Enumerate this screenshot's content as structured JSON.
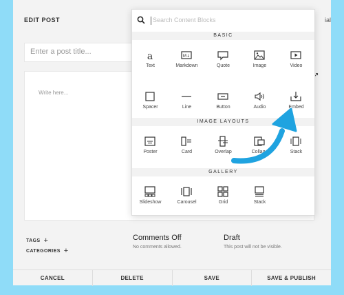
{
  "editor": {
    "title": "EDIT POST",
    "header_fragment": "ial",
    "title_placeholder": "Enter a post title...",
    "body_placeholder": "Write here...",
    "expand_glyph": "↗"
  },
  "popup": {
    "search_placeholder": "Search Content Blocks",
    "sections": {
      "basic": {
        "heading": "BASIC",
        "items": [
          "Text",
          "Markdown",
          "Quote",
          "Image",
          "Video",
          "Spacer",
          "Line",
          "Button",
          "Audio",
          "Embed"
        ]
      },
      "image_layouts": {
        "heading": "IMAGE LAYOUTS",
        "items": [
          "Poster",
          "Card",
          "Overlap",
          "Collage",
          "Stack"
        ]
      },
      "gallery": {
        "heading": "GALLERY",
        "items": [
          "Slideshow",
          "Carousel",
          "Grid",
          "Stack"
        ]
      }
    }
  },
  "meta": {
    "tags_label": "TAGS",
    "categories_label": "CATEGORIES",
    "plus": "+",
    "comments_title": "Comments Off",
    "comments_sub": "No comments allowed.",
    "status_title": "Draft",
    "status_sub": "This post will not be visible."
  },
  "footer": {
    "cancel": "CANCEL",
    "delete": "DELETE",
    "save": "SAVE",
    "save_publish": "SAVE & PUBLISH"
  },
  "colors": {
    "background": "#8fdcf8",
    "arrow": "#1fa3e0"
  }
}
